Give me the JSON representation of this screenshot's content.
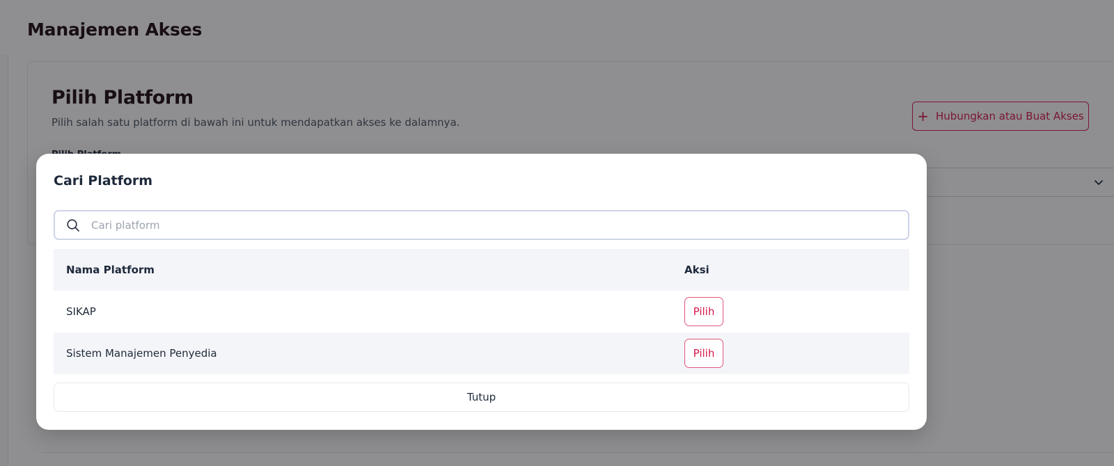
{
  "page": {
    "title": "Manajemen Akses"
  },
  "card": {
    "title": "Pilih Platform",
    "description": "Pilih salah satu platform di bawah ini untuk mendapatkan akses ke dalamnya.",
    "connect_button": {
      "icon": "plus-icon",
      "label": "Hubungkan atau Buat Akses"
    },
    "field_label": "Pilih Platform",
    "select_icon": "chevron-down-icon"
  },
  "modal": {
    "title": "Cari Platform",
    "search": {
      "placeholder": "Cari platform",
      "value": "",
      "icon": "search-icon"
    },
    "table": {
      "columns": [
        "Nama Platform",
        "Aksi"
      ],
      "rows": [
        {
          "name": "SIKAP",
          "action": "Pilih"
        },
        {
          "name": "Sistem Manajemen Penyedia",
          "action": "Pilih"
        }
      ]
    },
    "close_label": "Tutup"
  },
  "colors": {
    "accent": "#d7194b",
    "heading": "#1f0d12",
    "table_stripe": "#f4f5f9",
    "search_border": "#cfd4ea"
  }
}
